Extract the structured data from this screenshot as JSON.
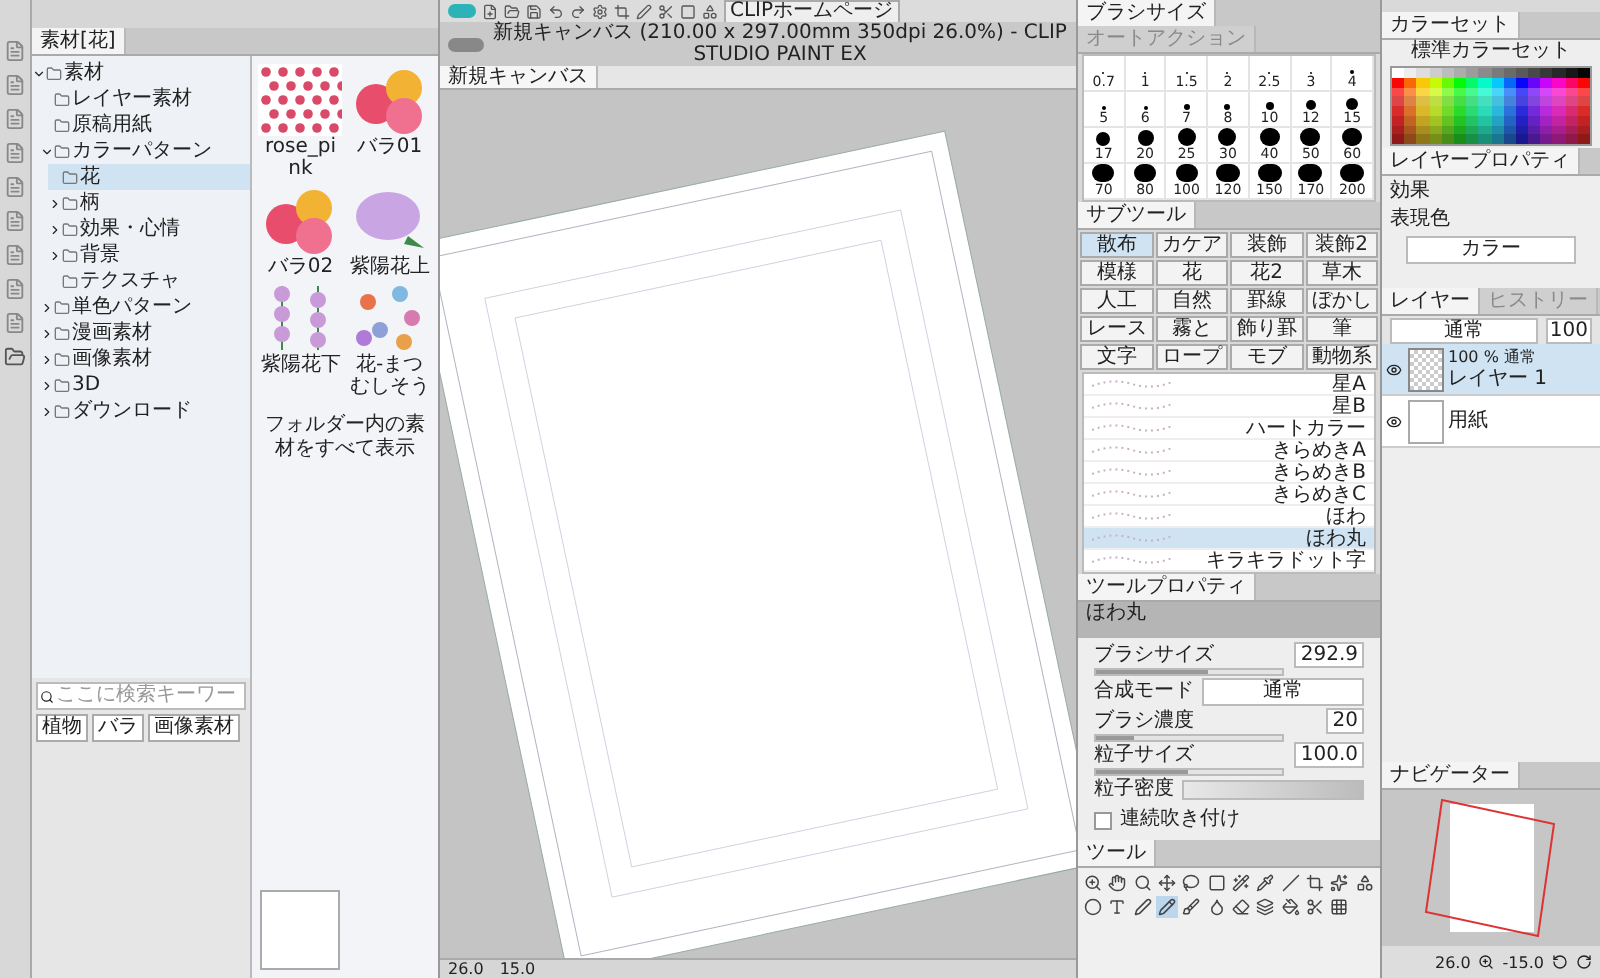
{
  "toolbar": {
    "home_button": "CLIPホームページ"
  },
  "window_title": "新規キャンバス (210.00 x 297.00mm 350dpi 26.0%) - CLIP STUDIO PAINT EX",
  "canvas_tab": "新規キャンバス",
  "status": {
    "zoom": "26.0",
    "angle": "15.0"
  },
  "material": {
    "tab": "素材[花]",
    "tree": [
      {
        "label": "素材",
        "expanded": true,
        "selected": false,
        "children": [
          {
            "label": "レイヤー素材",
            "selected": false
          },
          {
            "label": "原稿用紙",
            "selected": false
          },
          {
            "label": "カラーパターン",
            "expanded": true,
            "selected": false,
            "children": [
              {
                "label": "花",
                "selected": true
              },
              {
                "label": "柄",
                "expanded": false,
                "selected": false
              },
              {
                "label": "効果・心情",
                "expanded": false,
                "selected": false
              },
              {
                "label": "背景",
                "expanded": false,
                "selected": false
              },
              {
                "label": "テクスチャ",
                "selected": false
              }
            ]
          },
          {
            "label": "単色パターン",
            "expanded": false,
            "selected": false
          },
          {
            "label": "漫画素材",
            "expanded": false,
            "selected": false
          },
          {
            "label": "画像素材",
            "expanded": false,
            "selected": false
          },
          {
            "label": "3D",
            "expanded": false,
            "selected": false
          },
          {
            "label": "ダウンロード",
            "expanded": false,
            "selected": false
          }
        ]
      }
    ],
    "thumbnails": [
      {
        "label": "rose_pink",
        "kind": "pattern"
      },
      {
        "label": "バラ01",
        "kind": "roses"
      },
      {
        "label": "バラ02",
        "kind": "roses"
      },
      {
        "label": "紫陽花上",
        "kind": "hydrangea"
      },
      {
        "label": "紫陽花下",
        "kind": "vine"
      },
      {
        "label": "花-まつむしそう",
        "kind": "scatter"
      }
    ],
    "show_all": "フォルダー内の素材をすべて表示",
    "search": {
      "placeholder": "ここに検索キーワー"
    },
    "tags": [
      "植物",
      "バラ",
      "画像素材"
    ]
  },
  "brush_size": {
    "tabs": [
      {
        "label": "ブラシサイズ",
        "selected": true
      },
      {
        "label": "オートアクション",
        "selected": false
      }
    ],
    "sizes": [
      "0.7",
      "1",
      "1.5",
      "2",
      "2.5",
      "3",
      "4",
      "5",
      "6",
      "7",
      "8",
      "10",
      "12",
      "15",
      "17",
      "20",
      "25",
      "30",
      "40",
      "50",
      "60",
      "70",
      "80",
      "100",
      "120",
      "150",
      "170",
      "200"
    ]
  },
  "sub_tool": {
    "tab": "サブツール",
    "groups": [
      {
        "label": "散布",
        "selected": true
      },
      {
        "label": "カケア",
        "selected": false
      },
      {
        "label": "装飾",
        "selected": false
      },
      {
        "label": "装飾2",
        "selected": false
      },
      {
        "label": "模様",
        "selected": false
      },
      {
        "label": "花",
        "selected": false
      },
      {
        "label": "花2",
        "selected": false
      },
      {
        "label": "草木",
        "selected": false
      },
      {
        "label": "人工",
        "selected": false
      },
      {
        "label": "自然",
        "selected": false
      },
      {
        "label": "罫線",
        "selected": false
      },
      {
        "label": "ぼかし",
        "selected": false
      },
      {
        "label": "レース",
        "selected": false
      },
      {
        "label": "霧と",
        "selected": false
      },
      {
        "label": "飾り罫",
        "selected": false
      },
      {
        "label": "筆",
        "selected": false
      },
      {
        "label": "文字",
        "selected": false
      },
      {
        "label": "ロープ",
        "selected": false
      },
      {
        "label": "モブ",
        "selected": false
      },
      {
        "label": "動物系",
        "selected": false
      }
    ],
    "brushes": [
      {
        "label": "星A",
        "selected": false
      },
      {
        "label": "星B",
        "selected": false
      },
      {
        "label": "ハートカラー",
        "selected": false
      },
      {
        "label": "きらめきA",
        "selected": false
      },
      {
        "label": "きらめきB",
        "selected": false
      },
      {
        "label": "きらめきC",
        "selected": false
      },
      {
        "label": "ほわ",
        "selected": false
      },
      {
        "label": "ほわ丸",
        "selected": true
      },
      {
        "label": "キラキラドット字",
        "selected": false
      }
    ]
  },
  "tool_property": {
    "tab": "ツールプロパティ",
    "tool_name": "ほわ丸",
    "fields": [
      {
        "kind": "slider",
        "label": "ブラシサイズ",
        "value": "292.9",
        "level": 0.6
      },
      {
        "kind": "select",
        "label": "合成モード",
        "value": "通常"
      },
      {
        "kind": "slider",
        "label": "ブラシ濃度",
        "value": "20",
        "level": 0.2
      },
      {
        "kind": "slider",
        "label": "粒子サイズ",
        "value": "100.0",
        "level": 0.5
      },
      {
        "kind": "density",
        "label": "粒子密度"
      },
      {
        "kind": "checkbox",
        "label": "連続吹き付け",
        "checked": false
      }
    ]
  },
  "tools": {
    "tab": "ツール",
    "items": [
      {
        "selected": false
      },
      {
        "selected": false
      },
      {
        "selected": false
      },
      {
        "selected": false
      },
      {
        "selected": false
      },
      {
        "selected": false
      },
      {
        "selected": false
      },
      {
        "selected": false
      },
      {
        "selected": false
      },
      {
        "selected": false
      },
      {
        "selected": false
      },
      {
        "selected": false
      },
      {
        "selected": false
      },
      {
        "selected": false
      },
      {
        "selected": false
      },
      {
        "selected": true
      },
      {
        "selected": false
      },
      {
        "selected": false
      },
      {
        "selected": false
      },
      {
        "selected": false
      },
      {
        "selected": false
      },
      {
        "selected": false
      },
      {
        "selected": false
      }
    ]
  },
  "color_set": {
    "tab": "カラーセット",
    "set_name": "標準カラーセット"
  },
  "layer_property": {
    "tab": "レイヤープロパティ",
    "effect_label": "効果",
    "color_label": "表現色",
    "color_value": "カラー"
  },
  "layers": {
    "tabs": [
      {
        "label": "レイヤー",
        "selected": true
      },
      {
        "label": "ヒストリー",
        "selected": false
      }
    ],
    "blend": "通常",
    "opacity": "100",
    "items": [
      {
        "kind": "raster",
        "info": "100 % 通常",
        "label": "レイヤー 1",
        "selected": true,
        "visible": true
      },
      {
        "kind": "paper",
        "label": "用紙",
        "selected": false,
        "visible": true
      }
    ]
  },
  "navigator": {
    "tab": "ナビゲーター",
    "zoom": "26.0",
    "angle": "-15.0"
  }
}
